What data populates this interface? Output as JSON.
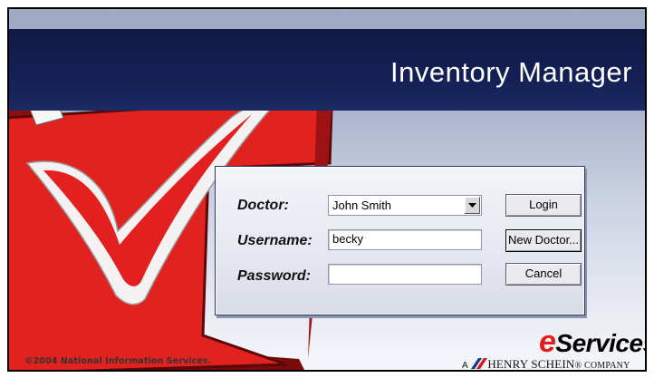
{
  "app": {
    "title": "Inventory Manager"
  },
  "login": {
    "doctor_label": "Doctor:",
    "doctor_value": "John Smith",
    "username_label": "Username:",
    "username_value": "becky",
    "password_label": "Password:",
    "password_value": "",
    "login_button": "Login",
    "new_doctor_button": "New Doctor...",
    "cancel_button": "Cancel"
  },
  "footer": {
    "copyright": "©2004 National Information Services.",
    "eservices_e": "e",
    "eservices_rest": "Services",
    "hs_prefix": "A",
    "hs_name": "HENRY SCHEIN",
    "hs_suffix": "® COMPANY"
  },
  "colors": {
    "banner": "#142055",
    "brand_red": "#e31b1b",
    "checkmark": "#e41f1f"
  }
}
